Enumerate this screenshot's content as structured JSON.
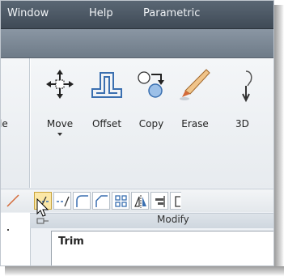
{
  "menu": {
    "items": [
      "Window",
      "Help",
      "Parametric"
    ]
  },
  "ribbon": {
    "partial_left_label": "le",
    "buttons": [
      {
        "label": "Move",
        "icon": "move-icon"
      },
      {
        "label": "Offset",
        "icon": "offset-icon"
      },
      {
        "label": "Copy",
        "icon": "copy-icon"
      },
      {
        "label": "Erase",
        "icon": "erase-icon"
      },
      {
        "label": "3D",
        "icon": "mirror-3d-icon"
      }
    ],
    "small_buttons": [
      {
        "name": "trim-button",
        "icon": "trim-icon",
        "active": true
      },
      {
        "name": "extend-button",
        "icon": "extend-icon",
        "active": false
      },
      {
        "name": "fillet-button",
        "icon": "fillet-icon",
        "active": false
      },
      {
        "name": "chamfer-button",
        "icon": "chamfer-icon",
        "active": false
      },
      {
        "name": "array-button",
        "icon": "array-icon",
        "active": false
      },
      {
        "name": "mirror-button",
        "icon": "mirror-icon",
        "active": false
      },
      {
        "name": "align-button",
        "icon": "align-icon",
        "active": false
      },
      {
        "name": "stretch-button",
        "icon": "stretch-icon",
        "active": false
      }
    ],
    "panel_title": "Modify"
  },
  "tooltip": {
    "title": "Trim"
  },
  "colors": {
    "menubar": "#4a5562",
    "ribbon_bg": "#eef1f5",
    "active_button": "#fbe7a6",
    "icon_blue": "#3a6fb0"
  }
}
